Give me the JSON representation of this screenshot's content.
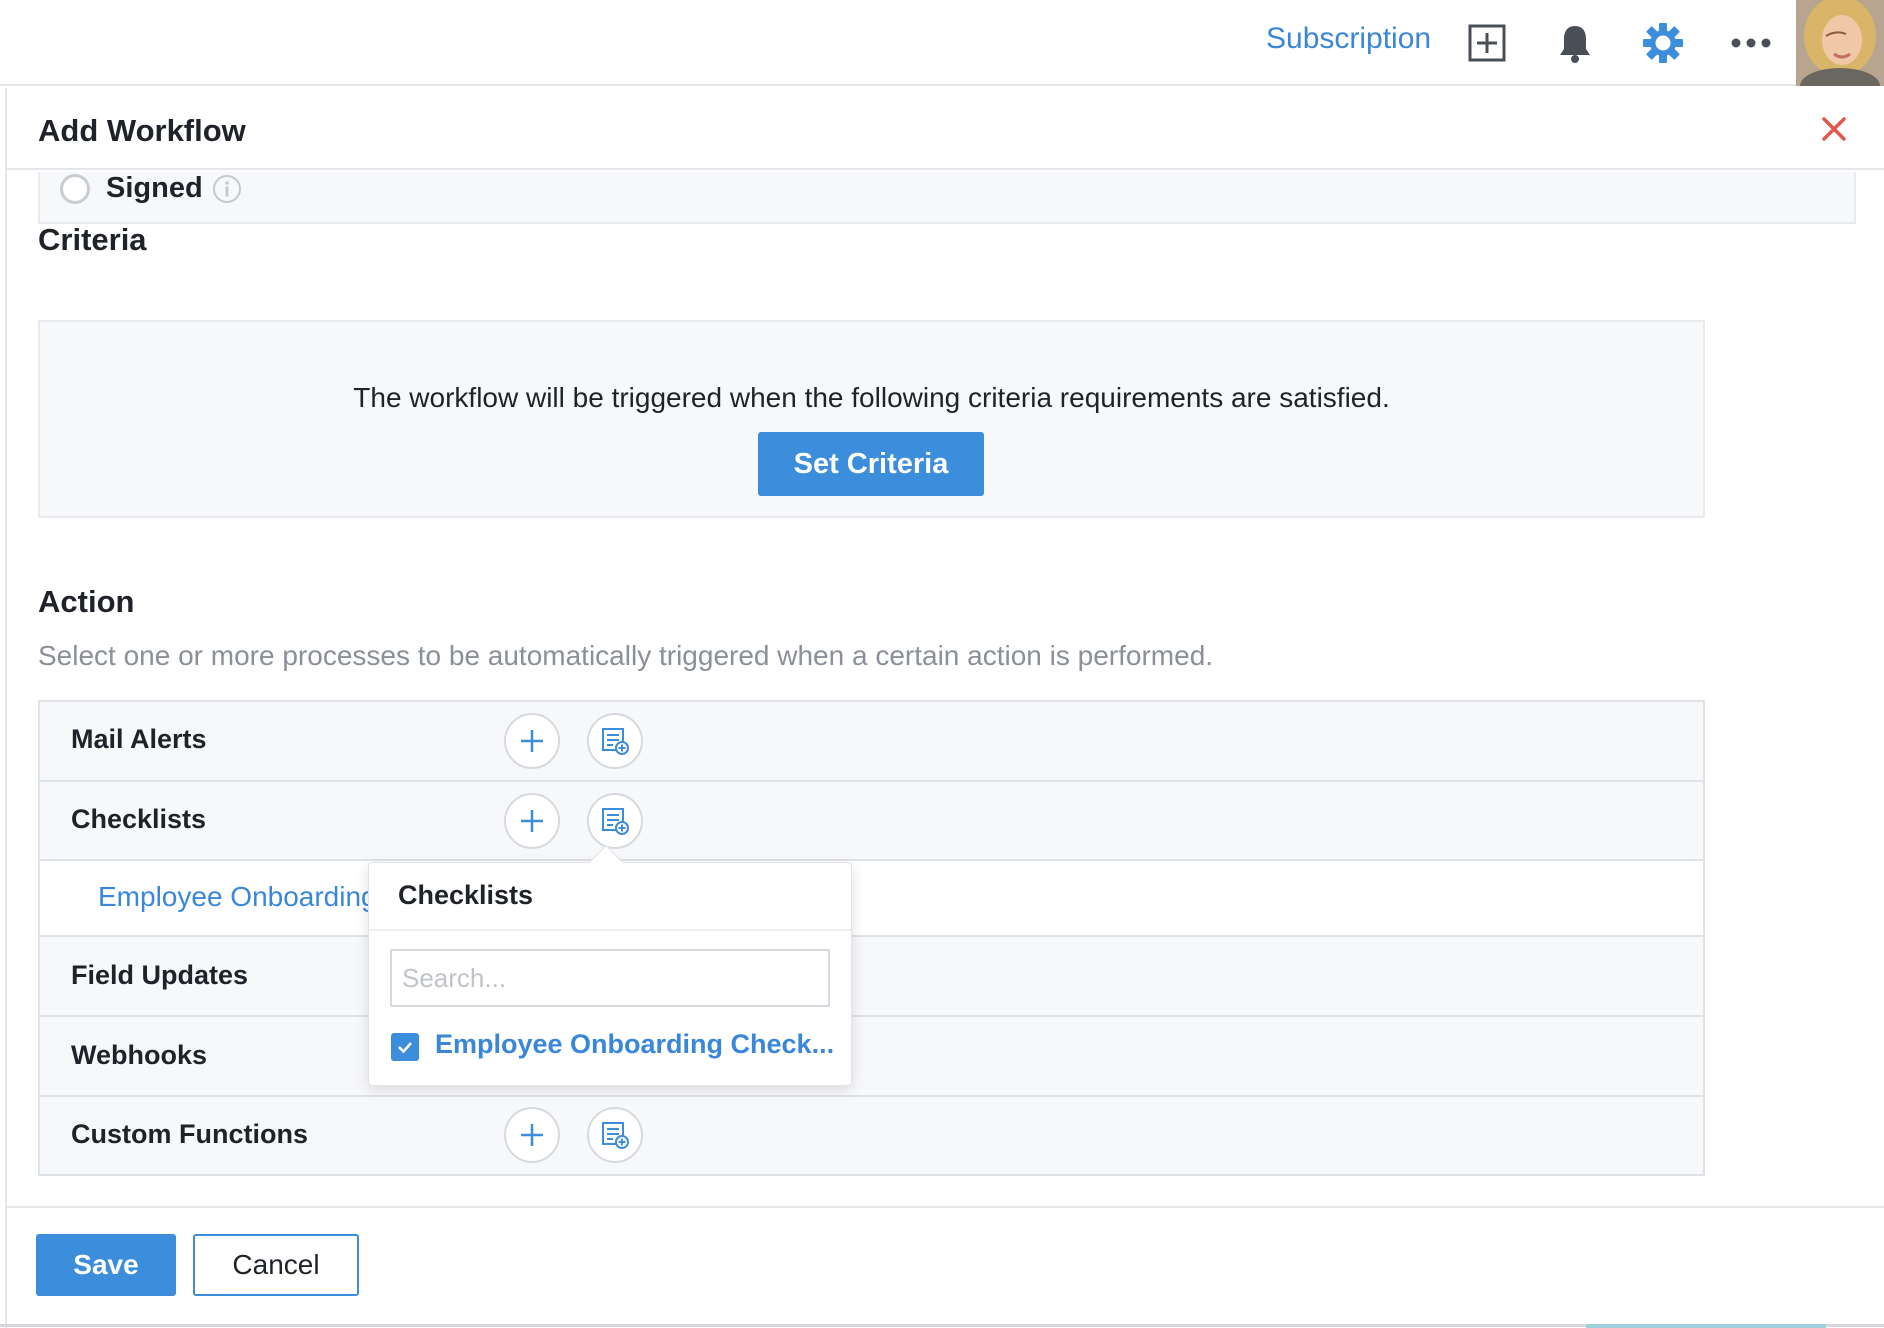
{
  "header": {
    "subscription_label": "Subscription",
    "icons": [
      "add-square-icon",
      "bell-icon",
      "gear-icon",
      "more-horizontal-icon"
    ]
  },
  "panel": {
    "title": "Add Workflow",
    "previous_option": {
      "label": "Signed"
    },
    "criteria": {
      "title": "Criteria",
      "description": "The workflow will be triggered when the following criteria requirements are satisfied.",
      "button_label": "Set Criteria"
    },
    "action": {
      "title": "Action",
      "description": "Select one or more processes to be automatically triggered when a certain action is performed.",
      "rows": [
        {
          "label": "Mail Alerts"
        },
        {
          "label": "Checklists"
        },
        {
          "label": "Employee Onboarding"
        },
        {
          "label": "Field Updates"
        },
        {
          "label": "Webhooks"
        },
        {
          "label": "Custom Functions"
        }
      ]
    },
    "popover": {
      "title": "Checklists",
      "search_placeholder": "Search...",
      "item_label": "Employee Onboarding Check...",
      "item_checked": true
    },
    "footer": {
      "save_label": "Save",
      "cancel_label": "Cancel"
    }
  },
  "colors": {
    "accent": "#3c8ddb",
    "link": "#3a87d9",
    "close": "#e2574c"
  }
}
